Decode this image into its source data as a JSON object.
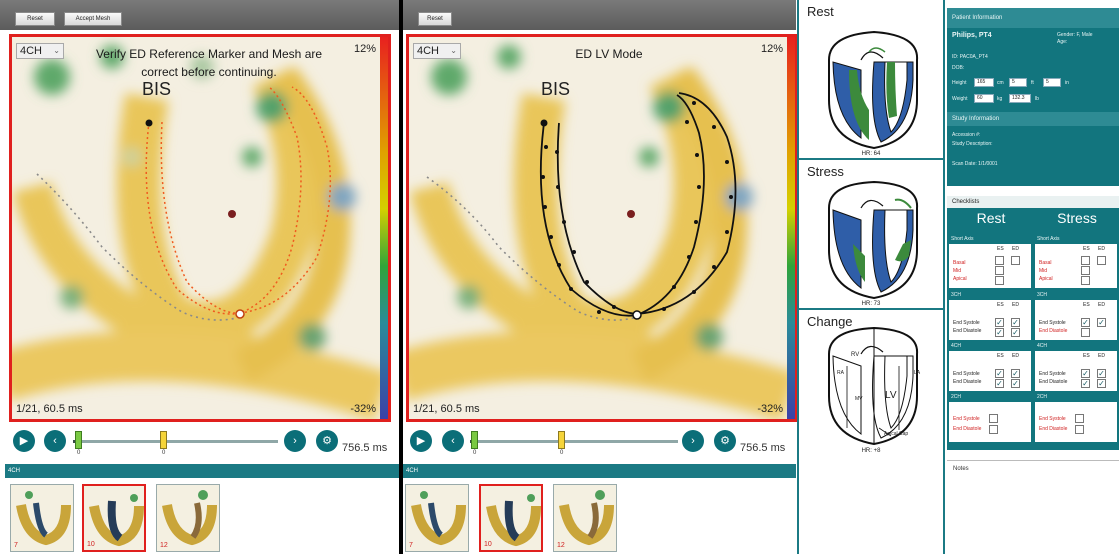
{
  "left_pane": {
    "toolbar": {
      "btn1": "Reset",
      "btn2": "Accept Mesh"
    },
    "view_select": "4CH",
    "message_line1": "Verify ED Reference Marker and Mesh are",
    "message_line2": "correct before continuing.",
    "pct_top": "12%",
    "pct_bottom": "-32%",
    "frame_time": "1/21, 60.5 ms",
    "bis_label": "BIS",
    "marker_es_label": "0",
    "marker_ed_label": "0",
    "time_total": "756.5 ms",
    "series_label": "4CH",
    "thumbnails": [
      {
        "num": "7"
      },
      {
        "num": "10"
      },
      {
        "num": "12"
      }
    ]
  },
  "mid_pane": {
    "toolbar": {
      "btn1": "Reset"
    },
    "view_select": "4CH",
    "message": "ED LV Mode",
    "pct_top": "12%",
    "pct_bottom": "-32%",
    "frame_time": "1/21, 60.5 ms",
    "bis_label": "BIS",
    "marker_es_label": "0",
    "marker_ed_label": "0",
    "time_total": "756.5 ms",
    "series_label": "4CH",
    "thumbnails": [
      {
        "num": "7"
      },
      {
        "num": "10"
      },
      {
        "num": "12"
      }
    ]
  },
  "bullseyes": {
    "rest": {
      "title": "Rest",
      "hr": "HR: 64"
    },
    "stress": {
      "title": "Stress",
      "hr": "HR: 73"
    },
    "change": {
      "title": "Change",
      "hr": "HR: +8",
      "labels": {
        "rv": "RV",
        "lv": "LV",
        "mv": "MV",
        "ra": "RA",
        "la": "LA",
        "apical": "Apical Cap"
      }
    }
  },
  "info": {
    "patient_title": "Patient Information",
    "patient_name": "Philips, PT4",
    "gender": "Gender: F, Male",
    "age": "Age:",
    "id": "ID: PAC0A_PT4",
    "dob": "DOB:",
    "height_label": "Height",
    "height_value": "165",
    "height_unit": "cm",
    "height_ft": "5",
    "ft_label": "ft",
    "in_value": "5",
    "in_label": "in",
    "weight_label": "Weight",
    "weight_value": "60",
    "weight_unit": "kg",
    "lb_value": "132.3",
    "lb_label": "lb",
    "study_title": "Study Information",
    "accession": "Accession #:",
    "study_desc": "Study Description:",
    "scan_date": "Scan Date: 1/1/0001"
  },
  "checklists": {
    "title": "Checklists",
    "rest_head": "Rest",
    "stress_head": "Stress",
    "short_axis": "Short Axis",
    "items_sa": [
      "Basal",
      "Mid",
      "Apical"
    ],
    "ch3": "3CH",
    "ch4": "4CH",
    "ch2": "2CH",
    "end_systole": "End Systole",
    "end_diastole": "End Diastole",
    "es_abbr": "ES",
    "ed_abbr": "ED",
    "check_glyph": "✓",
    "notes": "Notes"
  },
  "colors": {
    "accent": "#12757e",
    "red": "#e0201e",
    "mesh_orange": "#f05a1e"
  }
}
